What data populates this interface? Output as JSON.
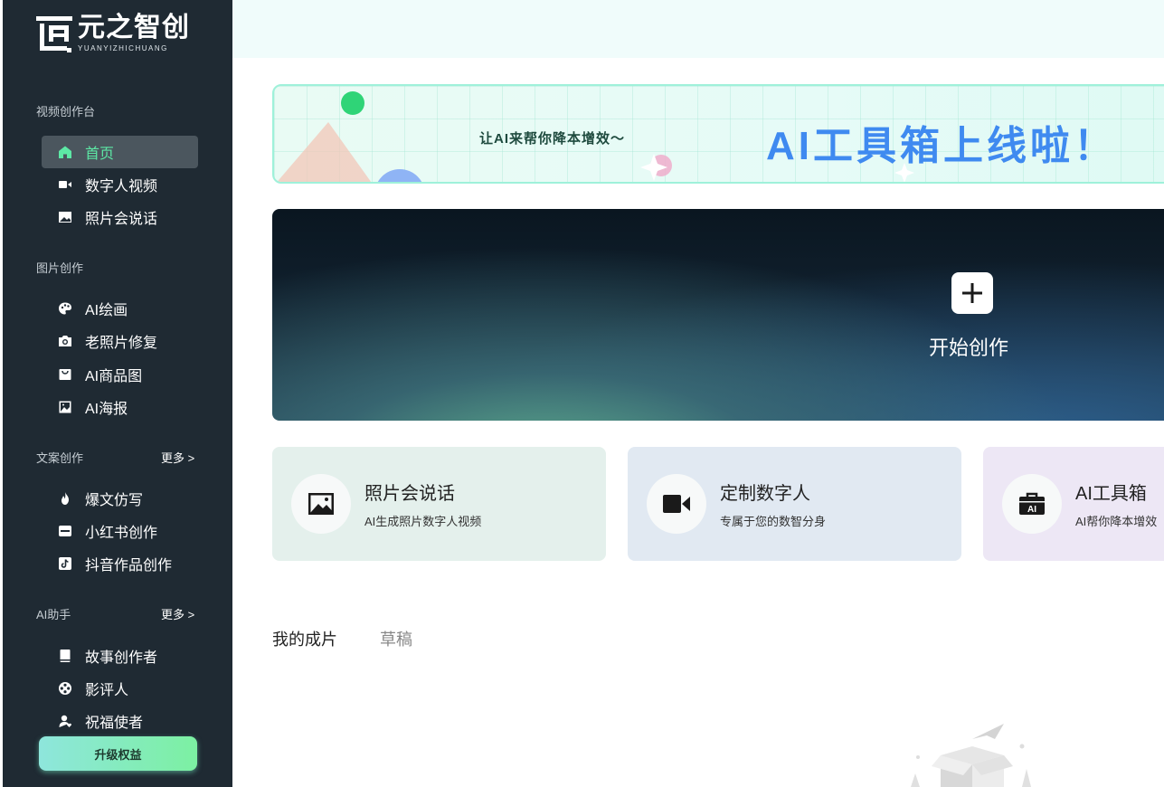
{
  "brand": {
    "name_cn": "元之智创",
    "name_en": "YUANYIZHICHUANG"
  },
  "sidebar": {
    "sections": [
      {
        "title": "视频创作台",
        "more": "",
        "items": [
          {
            "label": "首页",
            "icon": "home-icon",
            "active": true
          },
          {
            "label": "数字人视频",
            "icon": "video-camera-icon"
          },
          {
            "label": "照片会说话",
            "icon": "image-icon"
          }
        ]
      },
      {
        "title": "图片创作",
        "more": "",
        "items": [
          {
            "label": "AI绘画",
            "icon": "palette-icon"
          },
          {
            "label": "老照片修复",
            "icon": "camera-icon"
          },
          {
            "label": "AI商品图",
            "icon": "shopping-bag-icon"
          },
          {
            "label": "AI海报",
            "icon": "picture-icon"
          }
        ]
      },
      {
        "title": "文案创作",
        "more": "更多 >",
        "items": [
          {
            "label": "爆文仿写",
            "icon": "fire-icon"
          },
          {
            "label": "小红书创作",
            "icon": "xiaohongshu-icon"
          },
          {
            "label": "抖音作品创作",
            "icon": "douyin-icon"
          }
        ]
      },
      {
        "title": "AI助手",
        "more": "更多 >",
        "items": [
          {
            "label": "故事创作者",
            "icon": "book-icon"
          },
          {
            "label": "影评人",
            "icon": "film-reel-icon"
          },
          {
            "label": "祝福使者",
            "icon": "user-heart-icon"
          }
        ]
      }
    ],
    "upgrade_label": "升级权益"
  },
  "banner": {
    "subtitle": "让AI来帮你降本增效～",
    "title": "AI工具箱上线啦！"
  },
  "hero": {
    "label": "开始创作"
  },
  "cards": [
    {
      "title": "照片会说话",
      "desc": "AI生成照片数字人视频",
      "icon": "photo-talk-icon",
      "bg": "#e4f0ec"
    },
    {
      "title": "定制数字人",
      "desc": "专属于您的数智分身",
      "icon": "video-camera-icon",
      "bg": "#e1e9f2"
    },
    {
      "title": "AI工具箱",
      "desc": "AI帮你降本增效",
      "icon": "ai-toolbox-icon",
      "bg": "#ede7f5"
    }
  ],
  "tabs": [
    {
      "label": "我的成片",
      "active": true
    },
    {
      "label": "草稿",
      "active": false
    }
  ],
  "colors": {
    "sidebar_bg": "#1f2a33",
    "active_accent": "#5de8a5",
    "banner_title": "#3f8af0"
  }
}
